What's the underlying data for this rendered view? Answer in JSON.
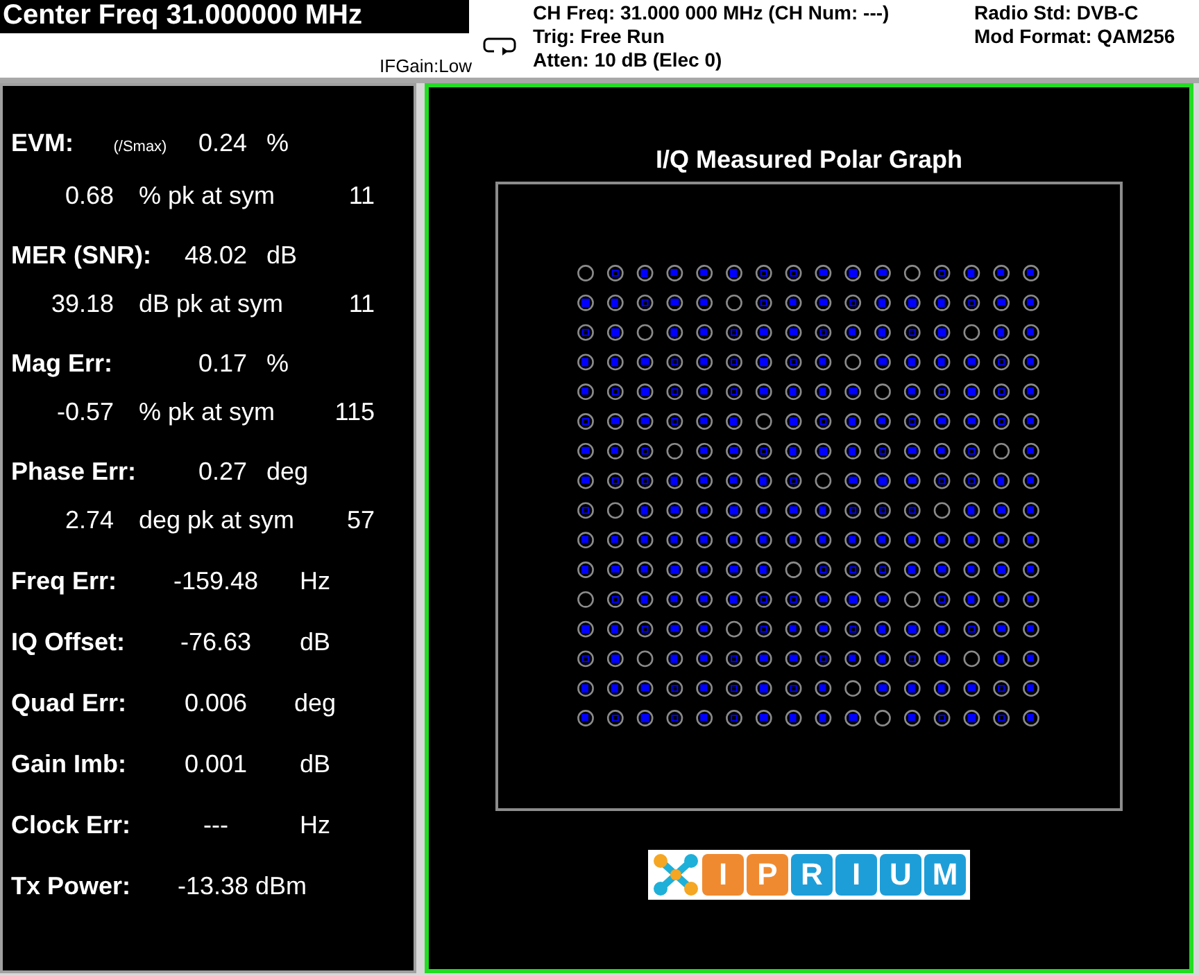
{
  "header": {
    "title": "Center Freq 31.000000 MHz",
    "if_gain": "IFGain:Low",
    "center_lines": [
      "CH Freq: 31.000 000 MHz (CH Num: ---)",
      "Trig: Free Run",
      "Atten: 10 dB (Elec 0)"
    ],
    "right_lines": [
      "Radio Std: DVB-C",
      "Mod Format: QAM256"
    ]
  },
  "metrics": [
    {
      "kind": "main",
      "label": "EVM:",
      "note": "(/Smax)",
      "value": "0.24",
      "unit": "%"
    },
    {
      "kind": "peak",
      "value": "0.68",
      "unit": "% pk at sym",
      "symbol": "11"
    },
    {
      "kind": "main",
      "label": "MER (SNR):",
      "value": "48.02",
      "unit": "dB"
    },
    {
      "kind": "peak",
      "value": "39.18",
      "unit": "dB pk at sym",
      "symbol": "11"
    },
    {
      "kind": "main",
      "label": "Mag Err:",
      "value": "0.17",
      "unit": "%"
    },
    {
      "kind": "peak",
      "value": "-0.57",
      "unit": "% pk at sym",
      "symbol": "115"
    },
    {
      "kind": "main",
      "label": "Phase Err:",
      "value": "0.27",
      "unit": "deg"
    },
    {
      "kind": "peak",
      "value": "2.74",
      "unit": "deg pk at sym",
      "symbol": "57"
    },
    {
      "kind": "simple",
      "label": "Freq Err:",
      "value": "-159.48",
      "unit": "Hz"
    },
    {
      "kind": "simple",
      "label": "IQ Offset:",
      "value": "-76.63",
      "unit": "dB"
    },
    {
      "kind": "simple",
      "label": "Quad Err:",
      "value": "0.006",
      "unit": "deg"
    },
    {
      "kind": "simple",
      "label": "Gain Imb:",
      "value": "0.001",
      "unit": "dB"
    },
    {
      "kind": "simple",
      "label": "Clock Err:",
      "value": "---",
      "unit": "Hz"
    },
    {
      "kind": "simple",
      "label": "Tx Power:",
      "value": "-13.38 dBm"
    }
  ],
  "graph": {
    "title": "I/Q Measured Polar Graph",
    "logo": [
      {
        "letter": "I",
        "color": "#f08a30"
      },
      {
        "letter": "P",
        "color": "#f08a30"
      },
      {
        "letter": "R",
        "color": "#1e9ed8"
      },
      {
        "letter": "I",
        "color": "#1e9ed8"
      },
      {
        "letter": "U",
        "color": "#1e9ed8"
      },
      {
        "letter": "M",
        "color": "#1e9ed8"
      }
    ]
  }
}
